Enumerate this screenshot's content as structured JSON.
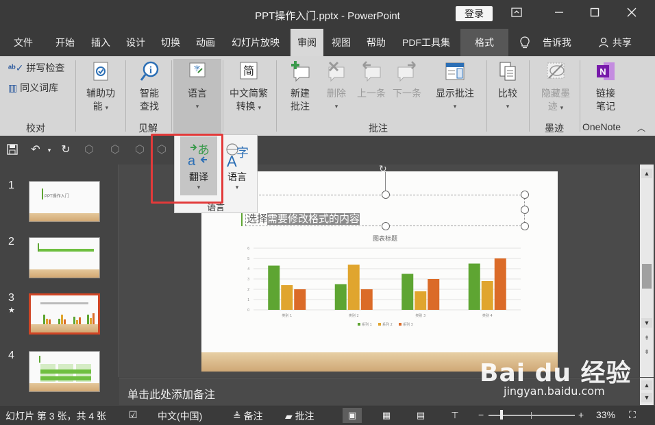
{
  "window": {
    "title": "PPT操作入门.pptx - PowerPoint",
    "login_label": "登录",
    "ribbon_display_icon": "ribbon-display-icon",
    "minimize_icon": "minimize-icon",
    "maximize_icon": "maximize-icon",
    "close_icon": "close-icon"
  },
  "menu": {
    "tabs": [
      "文件",
      "开始",
      "插入",
      "设计",
      "切换",
      "动画",
      "幻灯片放映",
      "审阅",
      "视图",
      "帮助",
      "PDF工具集",
      "格式"
    ],
    "active_tab": "审阅",
    "tell_me": "告诉我",
    "share": "共享"
  },
  "ribbon": {
    "proofing": {
      "spell": "拼写检查",
      "thesaurus": "同义词库",
      "group": "校对"
    },
    "accessibility": {
      "line1": "辅助功",
      "line2": "能"
    },
    "insights": {
      "line1": "智能",
      "line2": "查找",
      "group": "见解"
    },
    "language": {
      "label": "语言"
    },
    "chinese": {
      "line1": "中文简繁",
      "line2": "转换"
    },
    "comments": {
      "new_line1": "新建",
      "new_line2": "批注",
      "delete": "删除",
      "prev": "上一条",
      "next": "下一条",
      "show_line1": "显示批注",
      "group": "批注"
    },
    "compare": {
      "label": "比较"
    },
    "ink": {
      "line1": "隐藏墨",
      "line2": "迹",
      "group": "墨迹"
    },
    "onenote": {
      "line1": "链接",
      "line2": "笔记",
      "group": "OneNote"
    },
    "colors": {
      "accent": "#d04525",
      "highlight_box": "#e23a3a"
    }
  },
  "dropdown": {
    "translate": "翻译",
    "language": "语言",
    "group": "语言"
  },
  "thumbnails": [
    {
      "num": "1",
      "title": "PPT操作入门"
    },
    {
      "num": "2"
    },
    {
      "num": "3",
      "star": "★"
    },
    {
      "num": "4"
    }
  ],
  "slide": {
    "text_plain": "选择",
    "text_selected": "需要修改格式的内容",
    "chart_title": "图表标题"
  },
  "chart_data": {
    "type": "bar",
    "title": "图表标题",
    "categories": [
      "类别 1",
      "类别 2",
      "类别 3",
      "类别 4"
    ],
    "series": [
      {
        "name": "系列 1",
        "values": [
          4.3,
          2.5,
          3.5,
          4.5
        ],
        "color": "#5ea532"
      },
      {
        "name": "系列 2",
        "values": [
          2.4,
          4.4,
          1.8,
          2.8
        ],
        "color": "#e0a52e"
      },
      {
        "name": "系列 3",
        "values": [
          2,
          2,
          3,
          5
        ],
        "color": "#db6b28"
      }
    ],
    "ylim": [
      0,
      6
    ],
    "yticks": [
      "0",
      "1",
      "2",
      "3",
      "4",
      "5",
      "6"
    ],
    "grid": true,
    "legend": "bottom"
  },
  "notes": {
    "placeholder": "单击此处添加备注"
  },
  "status": {
    "slide_info": "幻灯片 第 3 张，共 4 张",
    "language": "中文(中国)",
    "notes": "备注",
    "comments": "批注",
    "zoom_minus": "−",
    "zoom_plus": "+",
    "zoom": "33%",
    "zoom_level": 0.33
  },
  "watermark": {
    "main": "Bai du 经验",
    "sub": "jingyan.baidu.com"
  }
}
